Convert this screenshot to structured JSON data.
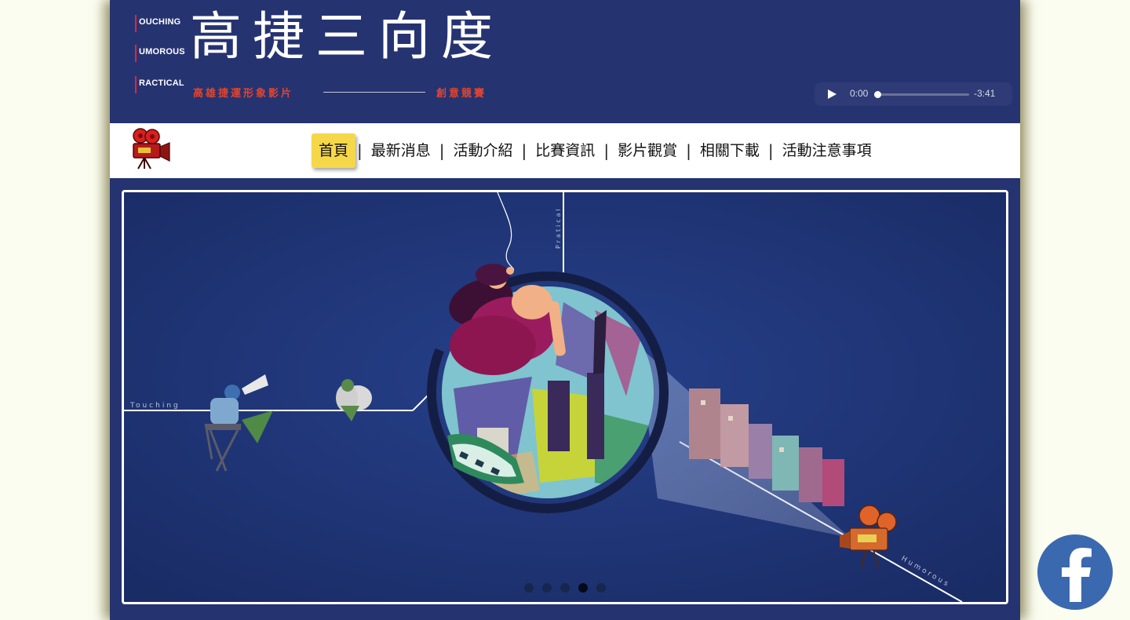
{
  "header": {
    "logo_words": [
      "OUCHING",
      "UMOROUS",
      "RACTICAL"
    ],
    "logo_main": "高捷三向度",
    "logo_sub": "高雄捷運形象影片",
    "logo_sub2": "創意競賽"
  },
  "audio": {
    "current_time": "0:00",
    "remaining_time": "-3:41",
    "progress": 0
  },
  "nav": {
    "items": [
      "首頁",
      "最新消息",
      "活動介紹",
      "比賽資訊",
      "影片觀賞",
      "相關下載",
      "活動注意事項"
    ],
    "active_index": 0
  },
  "hero": {
    "labels": {
      "touching": "Touching",
      "pratical": "Pratical",
      "humorous": "Humorous"
    },
    "slides": 5,
    "active_slide": 3
  },
  "colors": {
    "page_bg": "#fbfdf0",
    "header_bg": "#253371",
    "nav_active": "#f5d84a",
    "logo_accent": "#e2452e",
    "facebook": "#3b69b0"
  },
  "icons": {
    "nav_logo": "film-camera-icon",
    "play": "play-icon",
    "facebook": "facebook-icon"
  }
}
